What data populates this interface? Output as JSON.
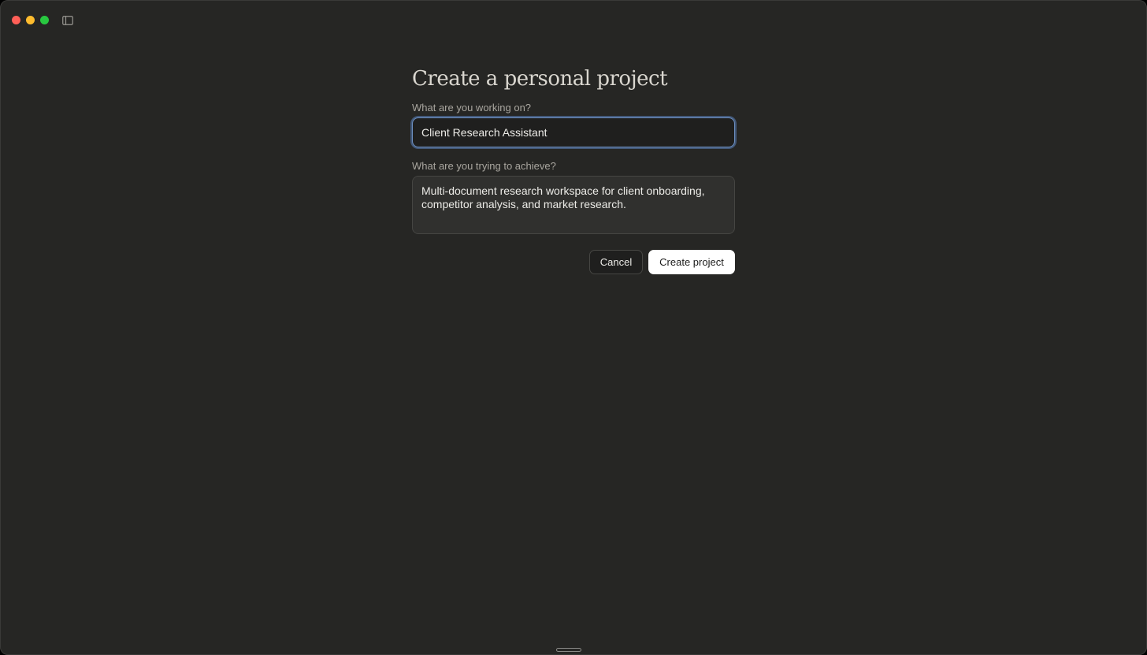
{
  "window": {
    "controls": [
      "close",
      "minimize",
      "maximize"
    ],
    "sidebar_toggle_icon": "sidebar-icon"
  },
  "form": {
    "title": "Create a personal project",
    "name_label": "What are you working on?",
    "name_value": "Client Research Assistant",
    "goal_label": "What are you trying to achieve?",
    "goal_value": "Multi-document research workspace for client onboarding, competitor analysis, and market research.",
    "cancel_label": "Cancel",
    "create_label": "Create project"
  },
  "colors": {
    "background": "#262624",
    "focus_ring": "#6d8fc0",
    "primary_button": "#ffffff"
  }
}
